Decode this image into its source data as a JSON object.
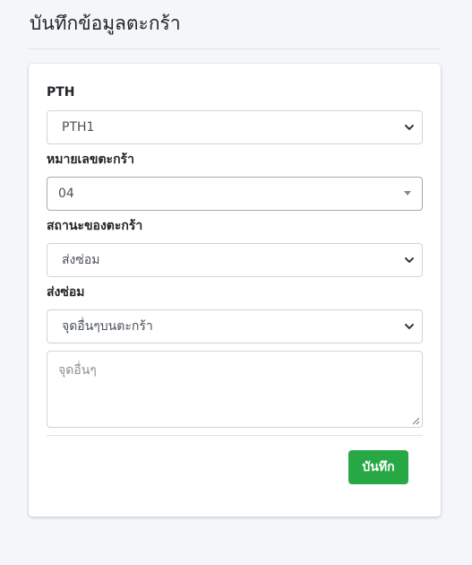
{
  "page": {
    "title": "บันทึกข้อมูลตะกร้า"
  },
  "form": {
    "pth_label": "PTH",
    "pth_value": "PTH1",
    "basket_no_label": "หมายเลขตะกร้า",
    "basket_no_value": "04",
    "basket_status_label": "สถานะของตะกร้า",
    "basket_status_value": "ส่งซ่อม",
    "repair_label": "ส่งซ่อม",
    "repair_value": "จุดอื่นๆบนตะกร้า",
    "other_placeholder": "จุดอื่นๆ",
    "save_label": "บันทึก"
  },
  "colors": {
    "save_button": "#28a745"
  },
  "icons": [
    "chevron-down-icon",
    "dropdown-caret-icon",
    "resize-grip-icon"
  ]
}
